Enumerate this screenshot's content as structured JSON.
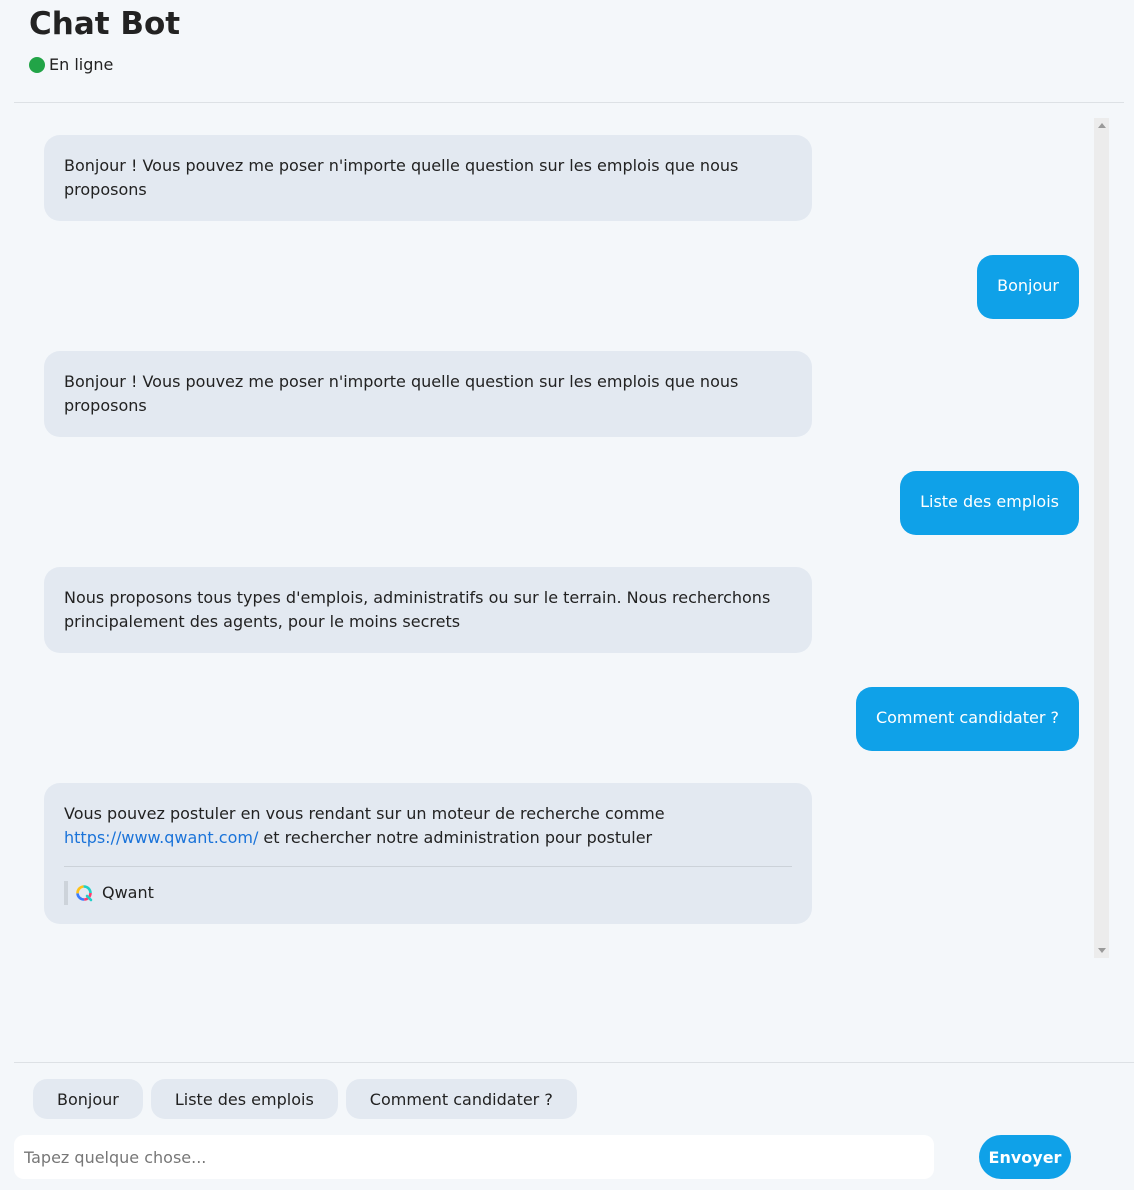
{
  "header": {
    "title": "Chat Bot",
    "status": "En ligne",
    "status_color": "#22a447"
  },
  "messages": [
    {
      "from": "bot",
      "text": "Bonjour ! Vous pouvez me poser n'importe quelle question sur les emplois que nous proposons"
    },
    {
      "from": "user",
      "text": "Bonjour"
    },
    {
      "from": "bot",
      "text": "Bonjour ! Vous pouvez me poser n'importe quelle question sur les emplois que nous proposons"
    },
    {
      "from": "user",
      "text": "Liste des emplois"
    },
    {
      "from": "bot",
      "text": "Nous proposons tous types d'emplois, administratifs ou sur le terrain. Nous recherchons principalement des agents, pour le moins secrets"
    },
    {
      "from": "user",
      "text": "Comment candidater ?"
    },
    {
      "from": "bot",
      "text_before": "Vous pouvez postuler en vous rendant sur un moteur de recherche comme",
      "link": "https://www.qwant.com/",
      "text_after": " et rechercher notre administration pour postuler",
      "preview": {
        "icon": "qwant-icon",
        "label": "Qwant"
      }
    }
  ],
  "suggestions": [
    "Bonjour",
    "Liste des emplois",
    "Comment candidater ?"
  ],
  "composer": {
    "placeholder": "Tapez quelque chose...",
    "value": "",
    "send_label": "Envoyer"
  },
  "colors": {
    "accent": "#0fa1e8",
    "bot_bubble": "#e3e9f1",
    "background": "#f4f7fa",
    "link": "#1a73d9"
  }
}
